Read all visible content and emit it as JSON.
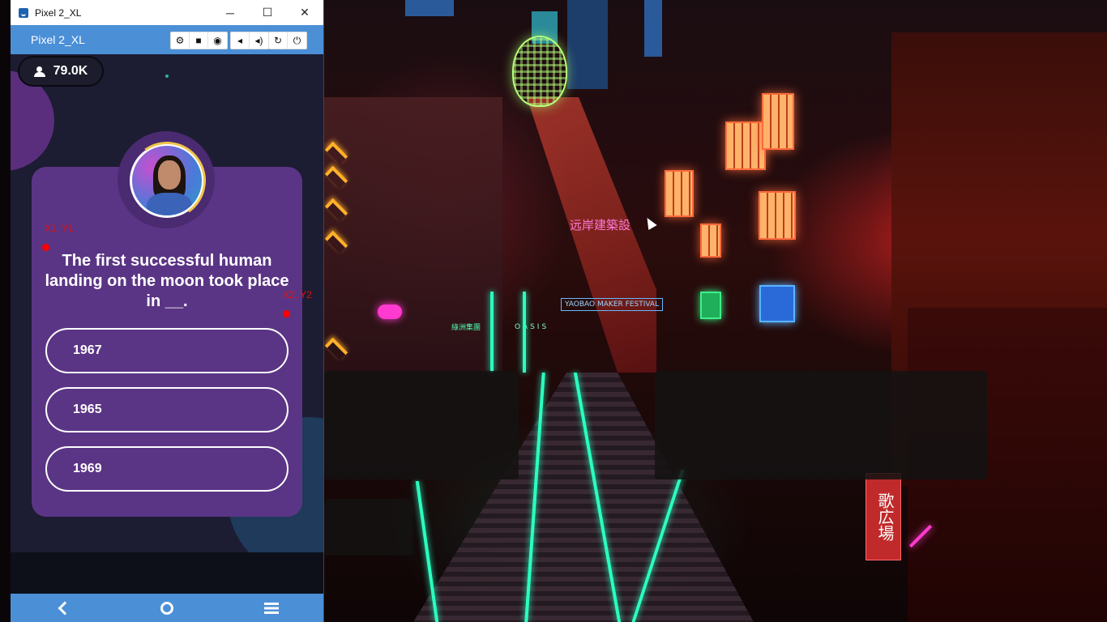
{
  "window": {
    "title": "Pixel 2_XL",
    "minimize_glyph": "─",
    "maximize_glyph": "☐",
    "close_glyph": "✕"
  },
  "toolbar": {
    "device_name": "Pixel 2_XL",
    "buttons": [
      {
        "icon": "settings-icon",
        "glyph": "⚙"
      },
      {
        "icon": "video-camera-icon",
        "glyph": "■"
      },
      {
        "icon": "screenshot-camera-icon",
        "glyph": "◉"
      },
      {
        "icon": "volume-down-icon",
        "glyph": "◂"
      },
      {
        "icon": "volume-up-icon",
        "glyph": "◂)"
      },
      {
        "icon": "rotate-icon",
        "glyph": "↻"
      },
      {
        "icon": "power-icon",
        "glyph": "⏻"
      }
    ]
  },
  "stream": {
    "viewer_count": "79.0K"
  },
  "quiz": {
    "question": "The first successful human landing on the moon took place in __.",
    "options": [
      "1967",
      "1965",
      "1969"
    ]
  },
  "markers": {
    "start_label": "X1, Y1",
    "end_label": "X2, Y2",
    "color": "#ff0000"
  },
  "colors": {
    "card": "#5b3585",
    "screen_bg": "#1c1c33",
    "toolbar": "#4b8fd7"
  },
  "wallpaper_signs": {
    "festival": "YAOBAO MAKER FESTIVAL",
    "oasis": "OASIS",
    "neon_kanji_top": "远岸建築設",
    "neon_kanji_right": "歌広場",
    "green_sign": "綠洲集團"
  }
}
